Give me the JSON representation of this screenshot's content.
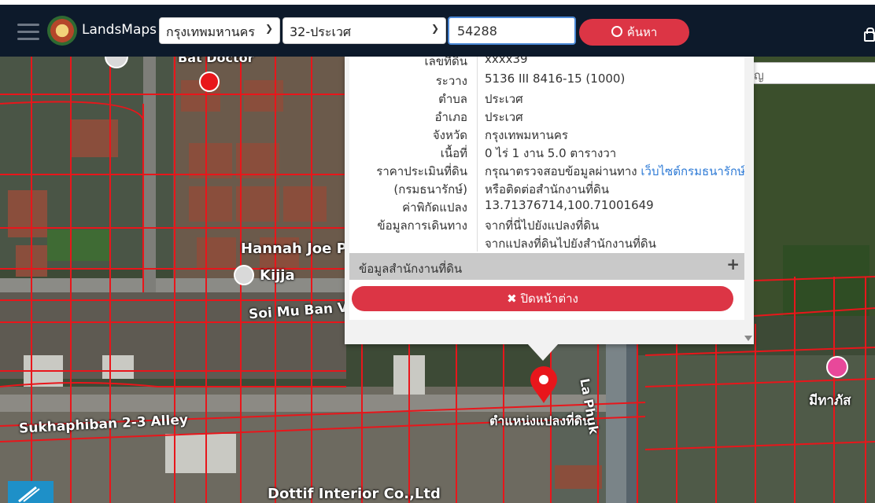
{
  "topbar": {
    "brand": "LandsMaps",
    "province": "กรุงเทพมหานคร",
    "district": "32-ประเวศ",
    "parcel_no": "54288",
    "search_label": "ค้นหา"
  },
  "landmark_search": {
    "placeholder": "ค้นหาสถานที่สำคัญ"
  },
  "popup": {
    "rows": [
      {
        "key": "เลขที่ดิน",
        "value": "xxxx39"
      },
      {
        "key": "ระวาง",
        "value": "5136 III 8416-15 (1000)"
      },
      {
        "key": "ตำบล",
        "value": "ประเวศ"
      },
      {
        "key": "อำเภอ",
        "value": "ประเวศ"
      },
      {
        "key": "จังหวัด",
        "value": "กรุงเทพมหานคร"
      },
      {
        "key": "เนื้อที่",
        "value": "0 ไร่ 1 งาน 5.0 ตารางวา"
      },
      {
        "key": "ราคาประเมินที่ดิน",
        "value": "กรุณาตรวจสอบข้อมูลผ่านทาง",
        "link": "เว็บไซต์กรมธนารักษ์"
      },
      {
        "key": "(กรมธนารักษ์)",
        "value": "หรือติดต่อสำนักงานที่ดิน"
      },
      {
        "key": "ค่าพิกัดแปลง",
        "link": "13.71376714,100.71001649"
      },
      {
        "key": "ข้อมูลการเดินทาง",
        "link": "จากที่นี่ไปยังแปลงที่ดิน"
      },
      {
        "key": "",
        "link": "จากแปลงที่ดินไปยังสำนักงานที่ดิน"
      }
    ],
    "office_section": "ข้อมูลสำนักงานที่ดิน",
    "close_label": "ปิดหน้าต่าง"
  },
  "map_labels": {
    "bat_doctor": "Bat Doctor",
    "hannah": "Hannah Joe Pi",
    "kijja": "Kijja",
    "soi_mu_ban": "Soi Mu Ban V",
    "sukhaphiban": "Sukhaphiban 2-3 Alley",
    "parcel_position": "ตำแหน่งแปลงที่ดิน",
    "la_phuk": "La Phuk",
    "dottif": "Dottif Interior Co.,Ltd",
    "right_sign": "มีทาภัส"
  },
  "colors": {
    "accent_red": "#dc3545",
    "topbar_bg": "#0d1a2b",
    "link_blue": "#2f7bd6",
    "parcel_lines": "#e8161b"
  }
}
